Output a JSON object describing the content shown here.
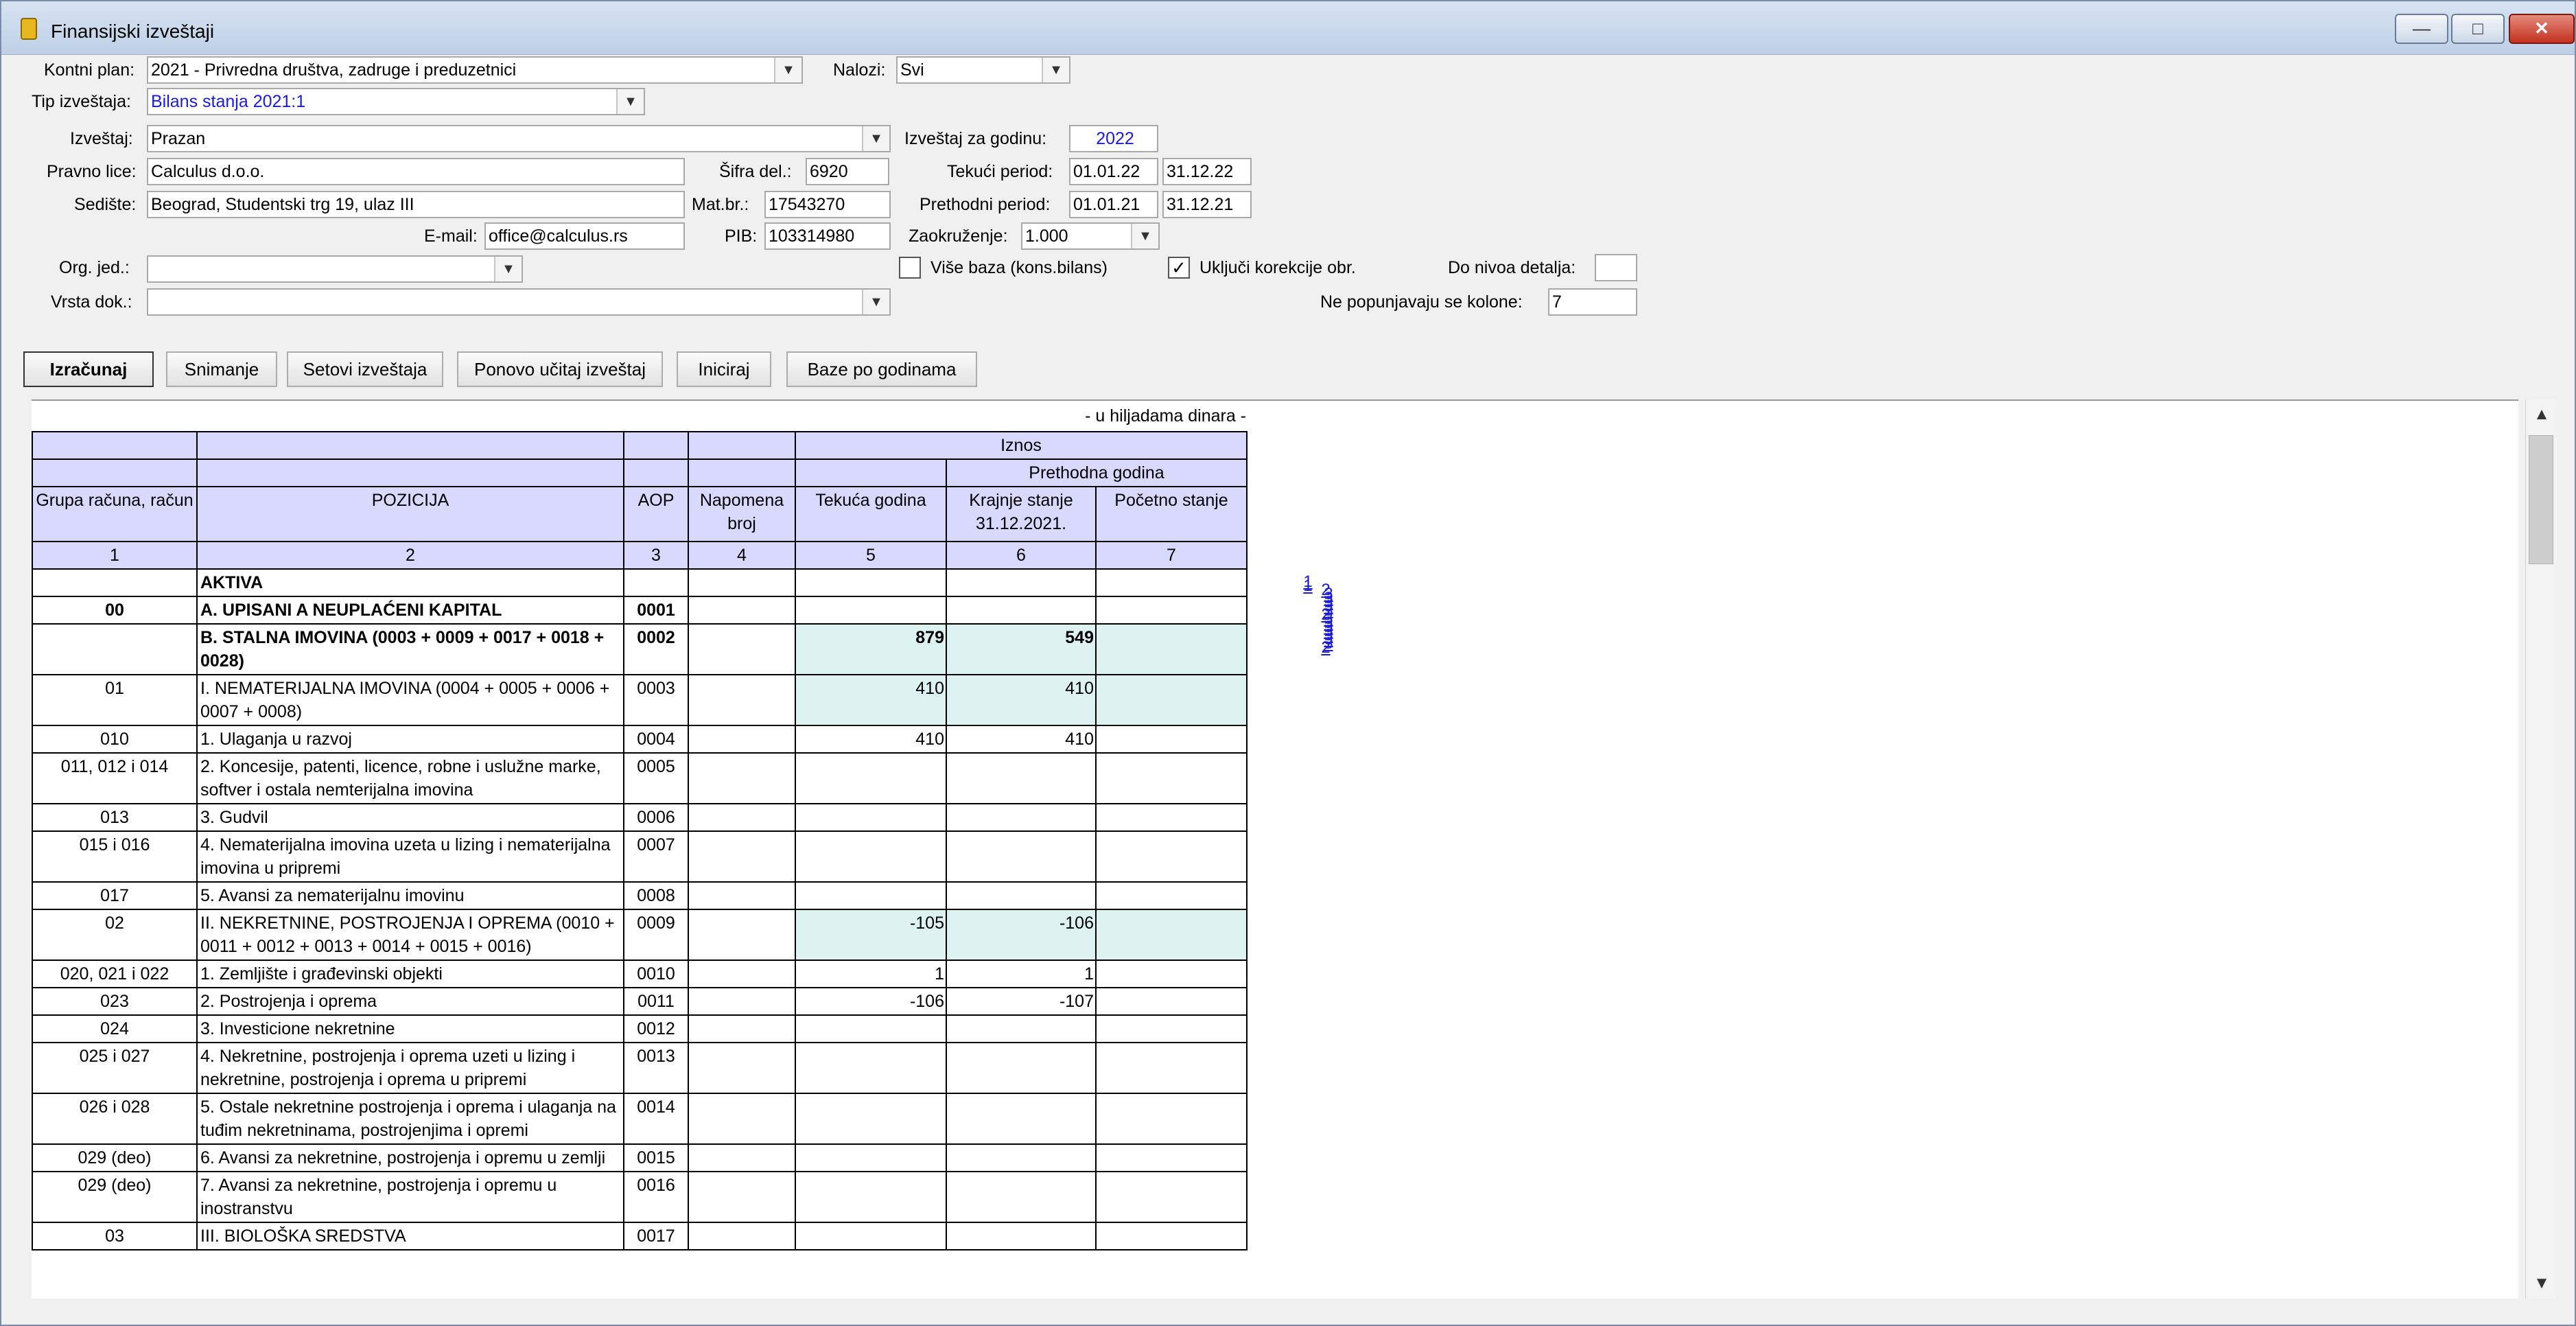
{
  "window": {
    "title": "Finansijski izveštaji",
    "min": "—",
    "max": "□",
    "close": "✕"
  },
  "form": {
    "kontni_plan": {
      "label": "Kontni plan:",
      "value": "2021 - Privredna društva, zadruge i preduzetnici"
    },
    "nalozi": {
      "label": "Nalozi:",
      "value": "Svi"
    },
    "tip_izvestaja": {
      "label": "Tip izveštaja:",
      "value": "Bilans stanja 2021:1"
    },
    "izvestaj": {
      "label": "Izveštaj:",
      "value": "Prazan"
    },
    "izvestaj_za_godinu": {
      "label": "Izveštaj za godinu:",
      "value": "2022"
    },
    "pravno_lice": {
      "label": "Pravno lice:",
      "value": "Calculus d.o.o."
    },
    "sifra_del": {
      "label": "Šifra del.:",
      "value": "6920"
    },
    "tekuci_period": {
      "label": "Tekući period:",
      "from": "01.01.22",
      "to": "31.12.22"
    },
    "sediste": {
      "label": "Sedište:",
      "value": "Beograd, Studentski trg 19, ulaz III"
    },
    "mat_br": {
      "label": "Mat.br.:",
      "value": "17543270"
    },
    "prethodni_period": {
      "label": "Prethodni period:",
      "from": "01.01.21",
      "to": "31.12.21"
    },
    "email": {
      "label": "E-mail:",
      "value": "office@calculus.rs"
    },
    "pib": {
      "label": "PIB:",
      "value": "103314980"
    },
    "zaokruzenje": {
      "label": "Zaokruženje:",
      "value": "1.000"
    },
    "org_jed": {
      "label": "Org. jed.:",
      "value": ""
    },
    "vise_baza": {
      "label": "Više baza (kons.bilans)",
      "checked": false
    },
    "ukljuci_korekcije": {
      "label": "Uključi korekcije obr.",
      "checked": true
    },
    "do_nivoa": {
      "label": "Do nivoa detalja:",
      "value": ""
    },
    "vrsta_dok": {
      "label": "Vrsta dok.:",
      "value": ""
    },
    "ne_popunjavaju": {
      "label": "Ne popunjavaju se kolone:",
      "value": "7"
    }
  },
  "toolbar": {
    "izracunaj": "Izračunaj",
    "snimanje": "Snimanje",
    "setovi": "Setovi izveštaja",
    "ponovo": "Ponovo učitaj izveštaj",
    "iniciraj": "Iniciraj",
    "baze": "Baze po godinama"
  },
  "report": {
    "unit": "- u hiljadama dinara -",
    "header": {
      "iznos": "Iznos",
      "prethodna": "Prethodna godina",
      "grupa": "Grupa računa, račun",
      "pozicija": "POZICIJA",
      "aop": "AOP",
      "napomena": "Napomena broj",
      "tekuca": "Tekuća godina",
      "krajnje": "Krajnje stanje 31.12.2021.",
      "pocetno": "Početno stanje",
      "n1": "1",
      "n2": "2",
      "n3": "3",
      "n4": "4",
      "n5": "5",
      "n6": "6",
      "n7": "7"
    },
    "rows": [
      {
        "grupa": "",
        "pozicija": "AKTIVA",
        "aop": "",
        "c5": "",
        "c6": "",
        "c7": "",
        "link": ""
      },
      {
        "grupa": "00",
        "pozicija": "A. UPISANI A NEUPLAĆENI KAPITAL",
        "aop": "0001",
        "c5": "",
        "c6": "",
        "c7": "",
        "link": "1"
      },
      {
        "grupa": "",
        "pozicija": "B. STALNA IMOVINA (0003 + 0009 + 0017 + 0018 + 0028)",
        "aop": "0002",
        "c5": "879",
        "c6": "549",
        "c7": "",
        "link": "1"
      },
      {
        "grupa": "01",
        "pozicija": "I. NEMATERIJALNA IMOVINA (0004 + 0005 + 0006 + 0007 + 0008)",
        "aop": "0003",
        "c5": "410",
        "c6": "410",
        "c7": "",
        "link": "2"
      },
      {
        "grupa": "010",
        "pozicija": "1. Ulaganja u razvoj",
        "aop": "0004",
        "c5": "410",
        "c6": "410",
        "c7": "",
        "link": "3"
      },
      {
        "grupa": "011, 012 i 014",
        "pozicija": "2. Koncesije, patenti, licence, robne i uslužne marke, softver i ostala nemterijalna imovina",
        "aop": "0005",
        "c5": "",
        "c6": "",
        "c7": "",
        "link": "3"
      },
      {
        "grupa": "013",
        "pozicija": "3. Gudvil",
        "aop": "0006",
        "c5": "",
        "c6": "",
        "c7": "",
        "link": "3"
      },
      {
        "grupa": "015 i 016",
        "pozicija": "4. Nematerijalna imovina uzeta u lizing i nematerijalna imovina u pripremi",
        "aop": "0007",
        "c5": "",
        "c6": "",
        "c7": "",
        "link": "3"
      },
      {
        "grupa": "017",
        "pozicija": "5. Avansi za nematerijalnu imovinu",
        "aop": "0008",
        "c5": "",
        "c6": "",
        "c7": "",
        "link": "3"
      },
      {
        "grupa": "02",
        "pozicija": "II. NEKRETNINE, POSTROJENJA I OPREMA (0010 + 0011 + 0012 + 0013 + 0014 + 0015 + 0016)",
        "aop": "0009",
        "c5": "-105",
        "c6": "-106",
        "c7": "",
        "link": "2"
      },
      {
        "grupa": "020, 021 i 022",
        "pozicija": "1. Zemljište i građevinski objekti",
        "aop": "0010",
        "c5": "1",
        "c6": "1",
        "c7": "",
        "link": "3"
      },
      {
        "grupa": "023",
        "pozicija": "2. Postrojenja i oprema",
        "aop": "0011",
        "c5": "-106",
        "c6": "-107",
        "c7": "",
        "link": "3"
      },
      {
        "grupa": "024",
        "pozicija": "3. Investicione nekretnine",
        "aop": "0012",
        "c5": "",
        "c6": "",
        "c7": "",
        "link": "3"
      },
      {
        "grupa": "025 i 027",
        "pozicija": "4. Nekretnine, postrojenja i oprema uzeti u lizing i nekretnine, postrojenja i oprema u pripremi",
        "aop": "0013",
        "c5": "",
        "c6": "",
        "c7": "",
        "link": "3"
      },
      {
        "grupa": "026 i 028",
        "pozicija": "5. Ostale nekretnine postrojenja i oprema i ulaganja na tuđim nekretninama, postrojenjima i opremi",
        "aop": "0014",
        "c5": "",
        "c6": "",
        "c7": "",
        "link": "3"
      },
      {
        "grupa": "029 (deo)",
        "pozicija": "6. Avansi za nekretnine, postrojenja i opremu u zemlji",
        "aop": "0015",
        "c5": "",
        "c6": "",
        "c7": "",
        "link": "3"
      },
      {
        "grupa": "029 (deo)",
        "pozicija": "7. Avansi za nekretnine, postrojenja i opremu u inostranstvu",
        "aop": "0016",
        "c5": "",
        "c6": "",
        "c7": "",
        "link": "3"
      },
      {
        "grupa": "03",
        "pozicija": "III. BIOLOŠKA SREDSTVA",
        "aop": "0017",
        "c5": "",
        "c6": "",
        "c7": "",
        "link": "2"
      }
    ]
  },
  "scrollbar": {
    "up": "▲",
    "down": "▼"
  }
}
